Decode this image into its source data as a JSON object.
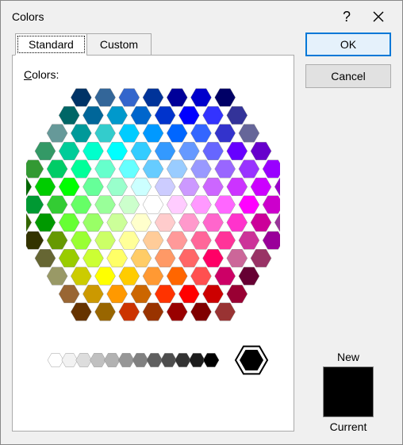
{
  "title": "Colors",
  "tabs": {
    "standard": "Standard",
    "custom": "Custom"
  },
  "colors_label_prefix": "C",
  "colors_label_rest": "olors:",
  "buttons": {
    "ok": "OK",
    "cancel": "Cancel"
  },
  "preview": {
    "new_label": "New",
    "current_label": "Current",
    "color": "#000000"
  },
  "hex_main": [
    {
      "r": 0,
      "cols": [
        "#003366",
        "#336699",
        "#3366CC",
        "#003399",
        "#000099",
        "#0000CC",
        "#000066"
      ]
    },
    {
      "r": 1,
      "cols": [
        "#006666",
        "#006699",
        "#0099CC",
        "#0066CC",
        "#0033CC",
        "#0000FF",
        "#3333FF",
        "#333399"
      ]
    },
    {
      "r": 2,
      "cols": [
        "#669999",
        "#009999",
        "#33CCCC",
        "#00CCFF",
        "#0099FF",
        "#0066FF",
        "#3366FF",
        "#3333CC",
        "#666699"
      ]
    },
    {
      "r": 3,
      "cols": [
        "#339966",
        "#00CC99",
        "#00FFCC",
        "#00FFFF",
        "#33CCFF",
        "#3399FF",
        "#6699FF",
        "#6666FF",
        "#6600FF",
        "#6600CC"
      ]
    },
    {
      "r": 4,
      "cols": [
        "#339933",
        "#00CC66",
        "#00FF99",
        "#66FFCC",
        "#66FFFF",
        "#66CCFF",
        "#99CCFF",
        "#9999FF",
        "#9966FF",
        "#9933FF",
        "#9900FF"
      ]
    },
    {
      "r": 5,
      "cols": [
        "#006600",
        "#00CC00",
        "#00FF00",
        "#66FF99",
        "#99FFCC",
        "#CCFFFF",
        "#CCCCFF",
        "#CC99FF",
        "#CC66FF",
        "#CC33FF",
        "#CC00FF",
        "#9900CC"
      ]
    },
    {
      "r": 6,
      "cols": [
        "#003300",
        "#009933",
        "#33CC33",
        "#66FF66",
        "#99FF99",
        "#CCFFCC",
        "#FFFFFF",
        "#FFCCFF",
        "#FF99FF",
        "#FF66FF",
        "#FF00FF",
        "#CC00CC",
        "#660066"
      ]
    },
    {
      "r": 7,
      "cols": [
        "#336600",
        "#009900",
        "#66FF33",
        "#99FF66",
        "#CCFF99",
        "#FFFFCC",
        "#FFCCCC",
        "#FF99CC",
        "#FF66CC",
        "#FF33CC",
        "#CC0099",
        "#993399"
      ]
    },
    {
      "r": 8,
      "cols": [
        "#333300",
        "#669900",
        "#99FF33",
        "#CCFF66",
        "#FFFF99",
        "#FFCC99",
        "#FF9999",
        "#FF6699",
        "#FF3399",
        "#CC3399",
        "#990099"
      ]
    },
    {
      "r": 9,
      "cols": [
        "#666633",
        "#99CC00",
        "#CCFF33",
        "#FFFF66",
        "#FFCC66",
        "#FF9966",
        "#FF6666",
        "#FF0066",
        "#CC6699",
        "#993366"
      ]
    },
    {
      "r": 10,
      "cols": [
        "#999966",
        "#CCCC00",
        "#FFFF00",
        "#FFCC00",
        "#FF9933",
        "#FF6600",
        "#FF5050",
        "#CC0066",
        "#660033"
      ]
    },
    {
      "r": 11,
      "cols": [
        "#996633",
        "#CC9900",
        "#FF9900",
        "#CC6600",
        "#FF3300",
        "#FF0000",
        "#CC0000",
        "#990033"
      ]
    },
    {
      "r": 12,
      "cols": [
        "#663300",
        "#996600",
        "#CC3300",
        "#993300",
        "#990000",
        "#800000",
        "#993333"
      ]
    }
  ],
  "gray_row": [
    "#FFFFFF",
    "#F2F2F2",
    "#DDDDDD",
    "#C0C0C0",
    "#B2B2B2",
    "#969696",
    "#808080",
    "#5F5F5F",
    "#4D4D4D",
    "#333333",
    "#1C1C1C",
    "#000000"
  ],
  "selected_big": "#000000"
}
